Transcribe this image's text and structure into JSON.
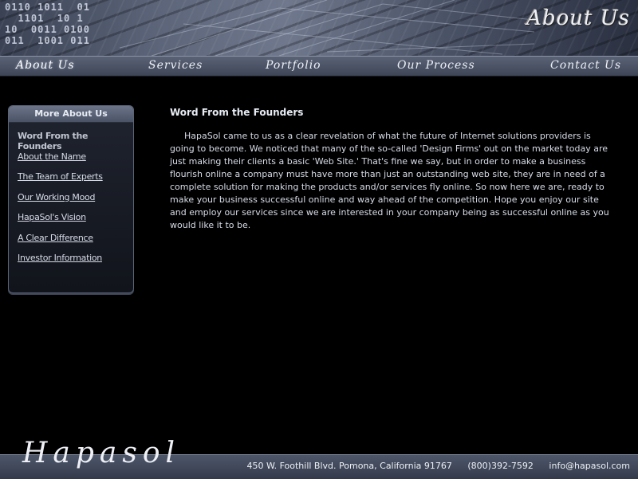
{
  "header": {
    "page_heading": "About Us",
    "binary_text": "0110 1011  01\n  1101  10 1\n10  0011 0100\n011  1001 011"
  },
  "nav": {
    "items": [
      {
        "label": "About Us",
        "active": true
      },
      {
        "label": "Services",
        "active": false
      },
      {
        "label": "Portfolio",
        "active": false
      },
      {
        "label": "Our Process",
        "active": false
      },
      {
        "label": "Contact Us",
        "active": false
      }
    ]
  },
  "sidebar": {
    "title": "More About Us",
    "items": [
      {
        "label": "Word From the Founders",
        "current": true
      },
      {
        "label": "About the Name",
        "current": false
      },
      {
        "label": "The Team of Experts",
        "current": false
      },
      {
        "label": "Our Working Mood",
        "current": false
      },
      {
        "label": "HapaSol's Vision",
        "current": false
      },
      {
        "label": "A Clear Difference",
        "current": false
      },
      {
        "label": "Investor Information",
        "current": false
      }
    ]
  },
  "main": {
    "heading": "Word From the Founders",
    "body": "HapaSol came to us as a clear revelation of what the future of Internet solutions providers is going to become. We noticed that many of the so-called 'Design Firms' out on the market today are just making their clients a basic 'Web Site.' That's fine we say, but in order to make a business flourish online a company must have more than just an outstanding web site, they are in need of a complete solution for making the products and/or services fly online. So now here we are, ready to make your business successful online and way ahead of the competition. Hope you enjoy our site and employ our services since we are interested in your company being as successful online as you would like it to be."
  },
  "footer": {
    "logo": "Hapasol",
    "address": "450 W. Foothill Blvd. Pomona, California 91767",
    "phone": "(800)392-7592",
    "email": "info@hapasol.com"
  }
}
